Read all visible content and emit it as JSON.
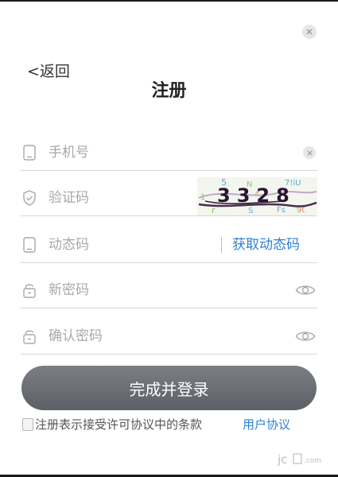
{
  "dialog": {
    "back_label": "<返回",
    "title": "注册"
  },
  "fields": {
    "phone": {
      "placeholder": "手机号",
      "icon": "phone-icon"
    },
    "captcha_code": {
      "placeholder": "验证码",
      "icon": "shield-icon",
      "captcha_text": "3328"
    },
    "sms_code": {
      "placeholder": "动态码",
      "icon": "phone-icon",
      "get_code_label": "获取动态码"
    },
    "password": {
      "placeholder": "新密码",
      "icon": "lock-icon"
    },
    "confirm_password": {
      "placeholder": "确认密码",
      "icon": "lock-icon"
    }
  },
  "submit": {
    "label": "完成并登录"
  },
  "agreement": {
    "checked": false,
    "text": "注册表示接受许可协议中的条款",
    "link_label": "用户协议"
  },
  "colors": {
    "accent": "#2f7fd6",
    "button": "#6b6e74",
    "placeholder": "#a8a8a8",
    "divider": "#d6d6d6"
  }
}
